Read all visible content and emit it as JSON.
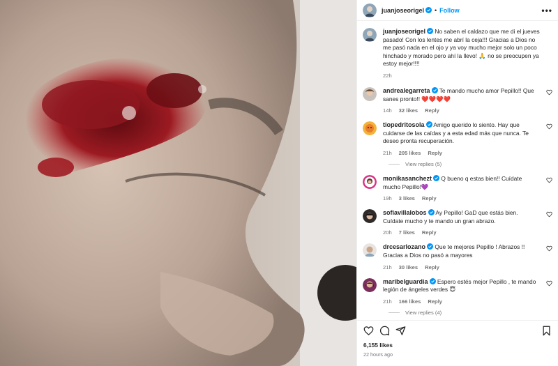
{
  "post": {
    "username": "juanjoseorigel",
    "follow_label": "Follow",
    "dot": "•",
    "more_label": "•••",
    "caption": "No saben el caldazo que me di el jueves pasado! Con los lentes me abrí la ceja!!! Gracias a Dios no me pasó nada en el ojo y ya voy mucho mejor solo un poco hinchado y morado pero ahí la llevo! 🙏 no se preocupen ya estoy mejor!!!!",
    "caption_time": "22h",
    "likes": "6,155 likes",
    "posted": "22 hours ago"
  },
  "comments": [
    {
      "username": "andrealegarreta",
      "text": "Te mando mucho amor Pepillo!! Que sanes pronto!! ❤️❤️❤️❤️",
      "time": "14h",
      "likes": "32 likes",
      "reply": "Reply"
    },
    {
      "username": "tiopedritosola",
      "text": "Amigo querido lo siento. Hay que cuidarse de las caídas y a esta edad más que nunca. Te deseo pronta recuperación.",
      "time": "21h",
      "likes": "205 likes",
      "reply": "Reply",
      "view_replies": "View replies (5)"
    },
    {
      "username": "monikasanchezt",
      "text": "Q bueno q estas bien!! Cuídate mucho Pepillo!💜",
      "time": "19h",
      "likes": "3 likes",
      "reply": "Reply"
    },
    {
      "username": "sofiavillalobos",
      "text": "Ay Pepillo! GaD que estás bien. Cuídate mucho y te mando un gran abrazo.",
      "time": "20h",
      "likes": "7 likes",
      "reply": "Reply"
    },
    {
      "username": "drcesarlozano",
      "text": "Que te mejores Pepillo ! Abrazos !! Gracias a Dios no pasó a mayores",
      "time": "21h",
      "likes": "30 likes",
      "reply": "Reply"
    },
    {
      "username": "maribelguardia",
      "text": "Espero estés mejor Pepillo , te mando legión de ángeles verdes 😇",
      "time": "21h",
      "likes": "166 likes",
      "reply": "Reply",
      "view_replies": "View replies (4)"
    }
  ],
  "icons": {
    "like": "heart-icon",
    "comment": "comment-icon",
    "share": "share-icon",
    "save": "bookmark-icon",
    "verified": "verified-badge-icon"
  },
  "colors": {
    "link": "#0095f6",
    "verified": "#0095f6",
    "muted": "#737373",
    "text": "#262626"
  }
}
